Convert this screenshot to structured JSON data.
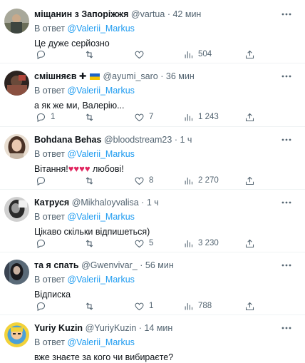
{
  "feed": {
    "tweets": [
      {
        "name": "міщанин з Запоріжжя",
        "handle": "@vartua",
        "time": "42 мин",
        "reply_prefix": "В ответ",
        "mention": "@Valerii_Markus",
        "text": "Це дуже серйозно",
        "replies": "",
        "retweets": "",
        "likes": "",
        "views": "504"
      },
      {
        "name": "смішняєв ✚",
        "handle": "@ayumi_saro",
        "time": "36 мин",
        "reply_prefix": "В ответ",
        "mention": "@Valerii_Markus",
        "text": "а як же ми, Валерію...",
        "replies": "1",
        "retweets": "",
        "likes": "7",
        "views": "1 243"
      },
      {
        "name": "Bohdana Behas",
        "handle": "@bloodstream23",
        "time": "1 ч",
        "reply_prefix": "В ответ",
        "mention": "@Valerii_Markus",
        "text_before": "Вітання!",
        "hearts": "♥♥♥♥",
        "text_after": " любові!",
        "replies": "",
        "retweets": "",
        "likes": "8",
        "views": "2 270"
      },
      {
        "name": "Катруся",
        "handle": "@Mikhaloyvalisa",
        "time": "1 ч",
        "reply_prefix": "В ответ",
        "mention": "@Valerii_Markus",
        "text": "Цікаво скільки відпишеться)",
        "replies": "",
        "retweets": "",
        "likes": "5",
        "views": "3 230"
      },
      {
        "name": "та я спать",
        "handle": "@Gwenvivar_",
        "time": "56 мин",
        "reply_prefix": "В ответ",
        "mention": "@Valerii_Markus",
        "text": "Відписка",
        "replies": "",
        "retweets": "",
        "likes": "1",
        "views": "788"
      },
      {
        "name": "Yuriy Kuzin",
        "handle": "@YuriyKuzin",
        "time": "14 мин",
        "reply_prefix": "В ответ",
        "mention": "@Valerii_Markus",
        "text": "вже знаєте за кого чи вибираєте?"
      }
    ]
  },
  "colors": {
    "link": "#1d9bf0",
    "muted": "#536471",
    "border": "#eff3f4",
    "heart": "#e0245e"
  },
  "icons": [
    "more-icon",
    "reply-icon",
    "retweet-icon",
    "like-icon",
    "views-icon",
    "share-icon"
  ]
}
